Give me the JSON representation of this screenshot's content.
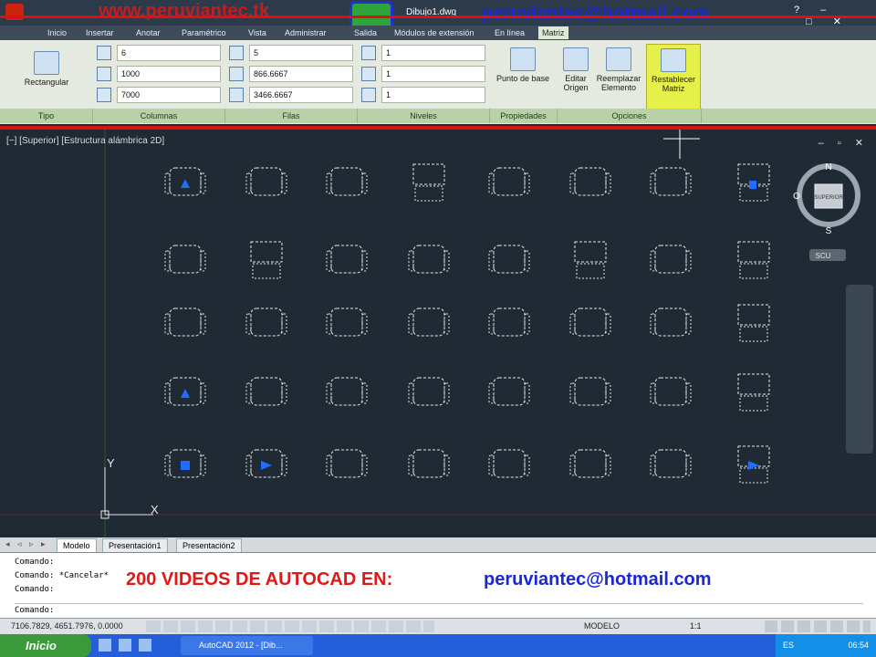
{
  "titlebar": {
    "file": "Dibujo1.dwg",
    "watermark_site": "www.peruviantec.tk",
    "watermark_email": "peruviantec@hotmail.com"
  },
  "ribbon_tabs": [
    "Inicio",
    "Insertar",
    "Anotar",
    "Paramétrico",
    "Vista",
    "Administrar",
    "Salida",
    "Módulos de extensión",
    "En línea",
    "Matriz"
  ],
  "ribbon": {
    "tipo": {
      "button": "Rectangular",
      "label": "Tipo"
    },
    "columnas": {
      "label": "Columnas",
      "values": [
        "6",
        "1000",
        "7000"
      ]
    },
    "filas": {
      "label": "Filas",
      "values": [
        "5",
        "866.6667",
        "3466.6667"
      ]
    },
    "niveles": {
      "label": "Niveles",
      "values": [
        "1",
        "1",
        "1"
      ]
    },
    "propiedades": {
      "button": "Punto de base",
      "label": "Propiedades"
    },
    "opciones": {
      "buttons": [
        "Editar Origen",
        "Reemplazar Elemento",
        "Restablecer Matriz"
      ],
      "label": "Opciones"
    }
  },
  "viewport": {
    "label": "[−] [Superior] [Estructura alámbrica 2D]",
    "ucs_x": "X",
    "ucs_y": "Y"
  },
  "viewcube": {
    "n": "N",
    "s": "S",
    "o": "O",
    "face": "SUPERIOR",
    "wcs": "SCU"
  },
  "layout_tabs": [
    "Modelo",
    "Presentación1",
    "Presentación2"
  ],
  "command": {
    "lines": [
      "Comando:",
      "Comando: *Cancelar*",
      "Comando:",
      "Comando:"
    ],
    "watermark_red": "200 VIDEOS DE AUTOCAD EN:",
    "watermark_blue": "peruviantec@hotmail.com"
  },
  "status": {
    "coords": "7106.7829, 4651.7976, 0.0000",
    "model": "MODELO",
    "scale": "1:1"
  },
  "taskbar": {
    "start": "Inicio",
    "app": "AutoCAD 2012 - [Dib...",
    "lang": "ES",
    "time": "06:54"
  },
  "colors": {
    "accent": "#e01010",
    "grip": "#1e6fff",
    "ribbon_green": "#b9d1a6"
  }
}
